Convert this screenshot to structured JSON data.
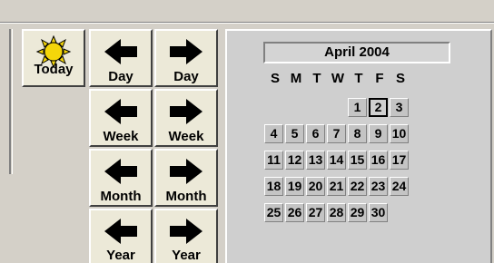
{
  "nav": {
    "today": "Today",
    "day_prev": "Day",
    "day_next": "Day",
    "week_prev": "Week",
    "week_next": "Week",
    "month_prev": "Month",
    "month_next": "Month",
    "year_prev": "Year",
    "year_next": "Year"
  },
  "calendar": {
    "title": "April 2004",
    "weekdays": [
      "S",
      "M",
      "T",
      "W",
      "T",
      "F",
      "S"
    ],
    "days": [
      "1",
      "2",
      "3",
      "4",
      "5",
      "6",
      "7",
      "8",
      "9",
      "10",
      "11",
      "12",
      "13",
      "14",
      "15",
      "16",
      "17",
      "18",
      "19",
      "20",
      "21",
      "22",
      "23",
      "24",
      "25",
      "26",
      "27",
      "28",
      "29",
      "30"
    ],
    "selected_day": "2"
  },
  "colors": {
    "window_bg": "#d4d0c8",
    "button_face": "#ece9d8",
    "sun": "#f4d60a",
    "arrow": "#000000"
  },
  "icons": {
    "today": "sun-icon",
    "prev": "left-arrow-icon",
    "next": "right-arrow-icon"
  }
}
